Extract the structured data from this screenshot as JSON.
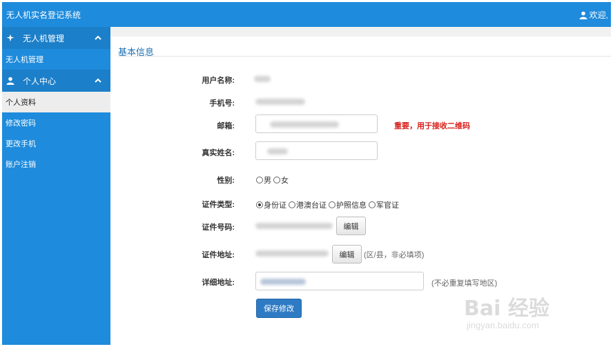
{
  "header": {
    "title": "无人机实名登记系统",
    "welcome": "欢迎,"
  },
  "sidebar": {
    "groups": [
      {
        "label": "无人机管理",
        "items": [
          "无人机管理"
        ]
      },
      {
        "label": "个人中心",
        "items": [
          "个人资料",
          "修改密码",
          "更改手机",
          "账户注销"
        ]
      }
    ],
    "active_item": "个人资料"
  },
  "main": {
    "section_title": "基本信息",
    "fields": {
      "username_label": "用户名称:",
      "phone_label": "手机号:",
      "email_label": "邮箱:",
      "email_note": "重要，用于接收二维码",
      "realname_label": "真实姓名:",
      "gender_label": "性别:",
      "gender_options": [
        "男",
        "女"
      ],
      "id_type_label": "证件类型:",
      "id_type_options": [
        "身份证",
        "港澳台证",
        "护照信息",
        "军官证"
      ],
      "id_type_selected": "身份证",
      "id_number_label": "证件号码:",
      "edit_label": "编辑",
      "id_address_label": "证件地址:",
      "id_address_hint": "(区/县，非必填项)",
      "detail_address_label": "详细地址:",
      "detail_address_hint": "(不必重复填写地区)"
    },
    "save_label": "保存修改"
  },
  "watermark": {
    "brand": "Bai 经验",
    "url": "jingyan.baidu.com"
  },
  "colors": {
    "primary": "#1e8bdc",
    "sidebar_header": "#1c7fc9",
    "title": "#1e6fb0",
    "important": "#d8201c",
    "save_button": "#2e7bc4"
  }
}
